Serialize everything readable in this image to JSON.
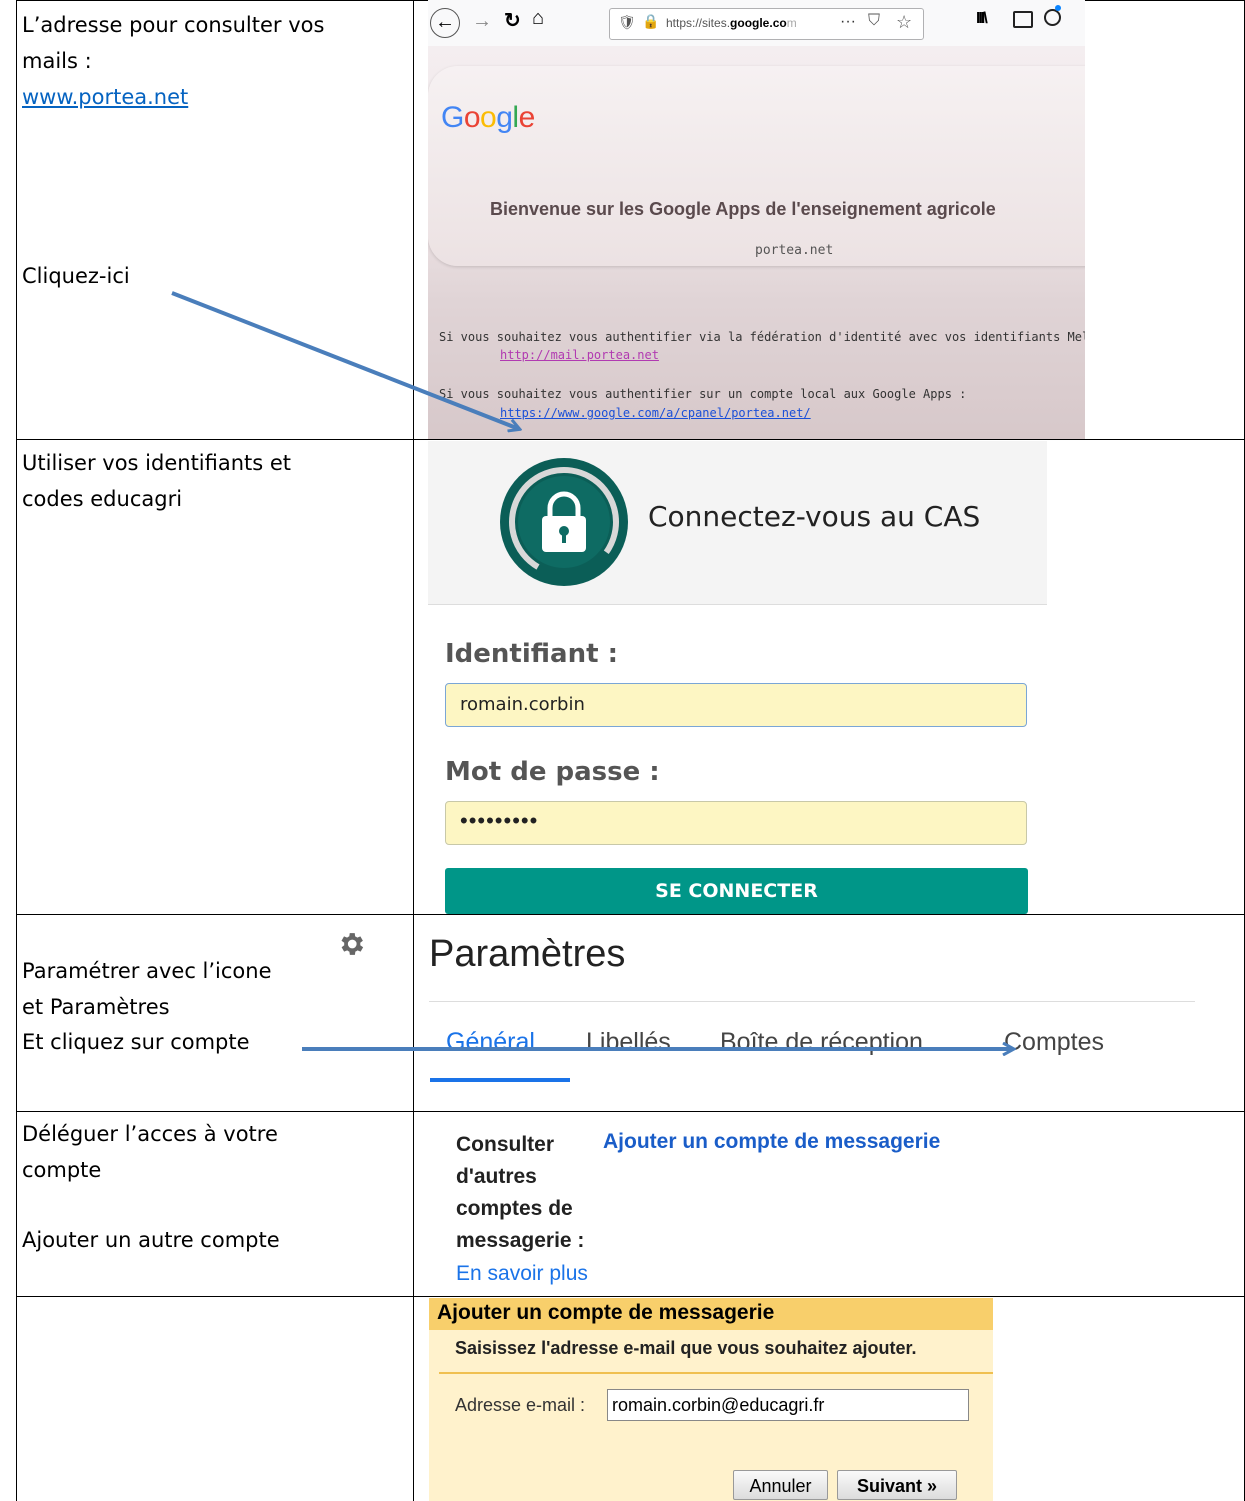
{
  "row1": {
    "left_line1": "L’adresse pour consulter vos",
    "left_line2": "mails :",
    "link": "www.portea.net",
    "clickhere": "Cliquez-ici",
    "browser": {
      "url": "https://sites.google.com",
      "url_prefix": "https://sites.",
      "url_domain": "google.co",
      "url_suffix": "m",
      "dots": "···"
    },
    "google_logo": [
      "G",
      "o",
      "o",
      "g",
      "l",
      "e"
    ],
    "google_colors": [
      "#4285f4",
      "#ea4335",
      "#fbbc05",
      "#4285f4",
      "#34a853",
      "#ea4335"
    ],
    "welcome": "Bienvenue sur les Google Apps de l'enseignement agricole",
    "site": "portea.net",
    "auth1": "Si vous souhaitez vous authentifier via la fédération d'identité avec vos identifiants Melagri :",
    "auth1_link": "http://mail.portea.net",
    "auth2": "Si vous souhaitez vous authentifier sur un compte local aux Google Apps :",
    "auth2_link": "https://www.google.com/a/cpanel/portea.net/"
  },
  "row2": {
    "left_line1": "Utiliser vos identifiants et",
    "left_line2": "codes educagri",
    "cas_title": "Connectez-vous au CAS",
    "id_label": "Identifiant :",
    "id_value": "romain.corbin",
    "pw_label": "Mot de passe :",
    "pw_value": "•••••••••",
    "button": "SE CONNECTER"
  },
  "row3": {
    "left_line1": "Paramétrer avec l’icone",
    "left_line2": "et Paramètres",
    "left_line3": "Et cliquez sur compte",
    "title": "Paramètres",
    "tabs": [
      "Général",
      "Libellés",
      "Boîte de réception",
      "Comptes"
    ]
  },
  "row4": {
    "left_line1": "Déléguer l’acces à votre",
    "left_line2": "compte",
    "left_line3": "Ajouter un autre compte",
    "label_lines": [
      "Consulter",
      "d'autres",
      "comptes de",
      "messagerie :"
    ],
    "learn_more": "En savoir plus",
    "add_account": "Ajouter un compte de messagerie"
  },
  "row5": {
    "header": "Ajouter un compte de messagerie",
    "prompt": "Saisissez l'adresse e-mail que vous souhaitez ajouter.",
    "email_label": "Adresse e-mail :",
    "email_value": "romain.corbin@educagri.fr",
    "cancel": "Annuler",
    "next": "Suivant »"
  },
  "colors": {
    "arrow": "#4a7ebb",
    "cas_teal": "#009688",
    "gmail_blue": "#1a73e8",
    "link_blue": "#0563c1"
  }
}
